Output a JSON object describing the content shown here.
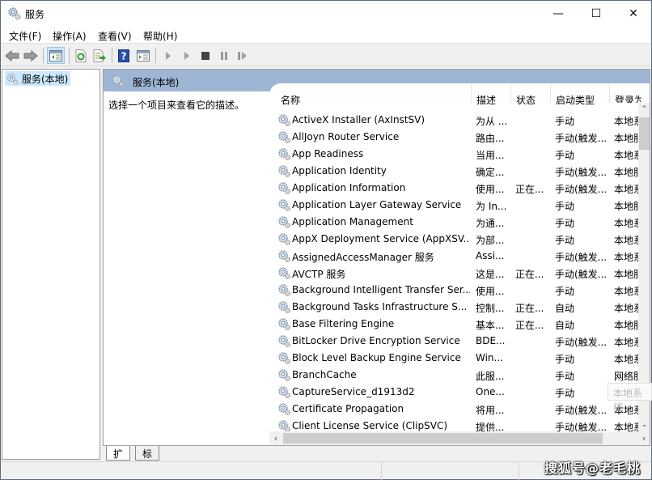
{
  "window": {
    "title": "服务",
    "controls": {
      "minimize": "—",
      "maximize": "☐",
      "close": "✕"
    }
  },
  "menubar": {
    "items": [
      {
        "label": "文件(F)"
      },
      {
        "label": "操作(A)"
      },
      {
        "label": "查看(V)"
      },
      {
        "label": "帮助(H)"
      }
    ]
  },
  "toolbar": {
    "buttons": [
      "back-icon",
      "forward-icon",
      "show-hide-console-tree-icon",
      "refresh-icon",
      "export-list-icon",
      "help-icon",
      "show-hide-action-pane-icon",
      "start-service-icon",
      "start-service-alt-icon",
      "stop-service-icon",
      "pause-service-icon",
      "resume-service-icon"
    ]
  },
  "tree": {
    "items": [
      {
        "label": "服务(本地)",
        "selected": true
      }
    ]
  },
  "pane": {
    "header_title": "服务(本地)",
    "description_hint": "选择一个项目来查看它的描述。"
  },
  "list": {
    "columns": [
      "名称",
      "描述",
      "状态",
      "启动类型",
      "登录为"
    ],
    "sort_indicator": "^",
    "rows": [
      {
        "name": "ActiveX Installer (AxInstSV)",
        "desc": "为从 ...",
        "status": "",
        "startup": "手动",
        "logon": "本地系"
      },
      {
        "name": "AllJoyn Router Service",
        "desc": "路由...",
        "status": "",
        "startup": "手动(触发...",
        "logon": "本地服"
      },
      {
        "name": "App Readiness",
        "desc": "当用...",
        "status": "",
        "startup": "手动",
        "logon": "本地系"
      },
      {
        "name": "Application Identity",
        "desc": "确定...",
        "status": "",
        "startup": "手动(触发...",
        "logon": "本地服"
      },
      {
        "name": "Application Information",
        "desc": "使用...",
        "status": "正在...",
        "startup": "手动(触发...",
        "logon": "本地系"
      },
      {
        "name": "Application Layer Gateway Service",
        "desc": "为 In...",
        "status": "",
        "startup": "手动",
        "logon": "本地服"
      },
      {
        "name": "Application Management",
        "desc": "为通...",
        "status": "",
        "startup": "手动",
        "logon": "本地系"
      },
      {
        "name": "AppX Deployment Service (AppXSV...",
        "desc": "为部...",
        "status": "",
        "startup": "手动",
        "logon": "本地系"
      },
      {
        "name": "AssignedAccessManager 服务",
        "desc": "Assi...",
        "status": "",
        "startup": "手动(触发...",
        "logon": "本地系"
      },
      {
        "name": "AVCTP 服务",
        "desc": "这是...",
        "status": "正在...",
        "startup": "手动(触发...",
        "logon": "本地服"
      },
      {
        "name": "Background Intelligent Transfer Ser...",
        "desc": "使用...",
        "status": "",
        "startup": "手动",
        "logon": "本地系"
      },
      {
        "name": "Background Tasks Infrastructure S...",
        "desc": "控制...",
        "status": "正在...",
        "startup": "自动",
        "logon": "本地系"
      },
      {
        "name": "Base Filtering Engine",
        "desc": "基本...",
        "status": "正在...",
        "startup": "自动",
        "logon": "本地服"
      },
      {
        "name": "BitLocker Drive Encryption Service",
        "desc": "BDE...",
        "status": "",
        "startup": "手动(触发...",
        "logon": "本地系"
      },
      {
        "name": "Block Level Backup Engine Service",
        "desc": "Win...",
        "status": "",
        "startup": "手动",
        "logon": "本地系"
      },
      {
        "name": "BranchCache",
        "desc": "此服...",
        "status": "",
        "startup": "手动",
        "logon": "网络服"
      },
      {
        "name": "CaptureService_d1913d2",
        "desc": "One...",
        "status": "",
        "startup": "手动",
        "logon": "本地系"
      },
      {
        "name": "Certificate Propagation",
        "desc": "将用...",
        "status": "",
        "startup": "手动(触发...",
        "logon": "本地系"
      },
      {
        "name": "Client License Service (ClipSVC)",
        "desc": "提供...",
        "status": "",
        "startup": "手动(触发...",
        "logon": "本地系"
      }
    ],
    "tooltip_fragment": "本地系统"
  },
  "tabs": [
    {
      "label": "扩展",
      "active": true
    },
    {
      "label": "标准",
      "active": false
    }
  ],
  "watermark": "搜狐号@老毛桃"
}
